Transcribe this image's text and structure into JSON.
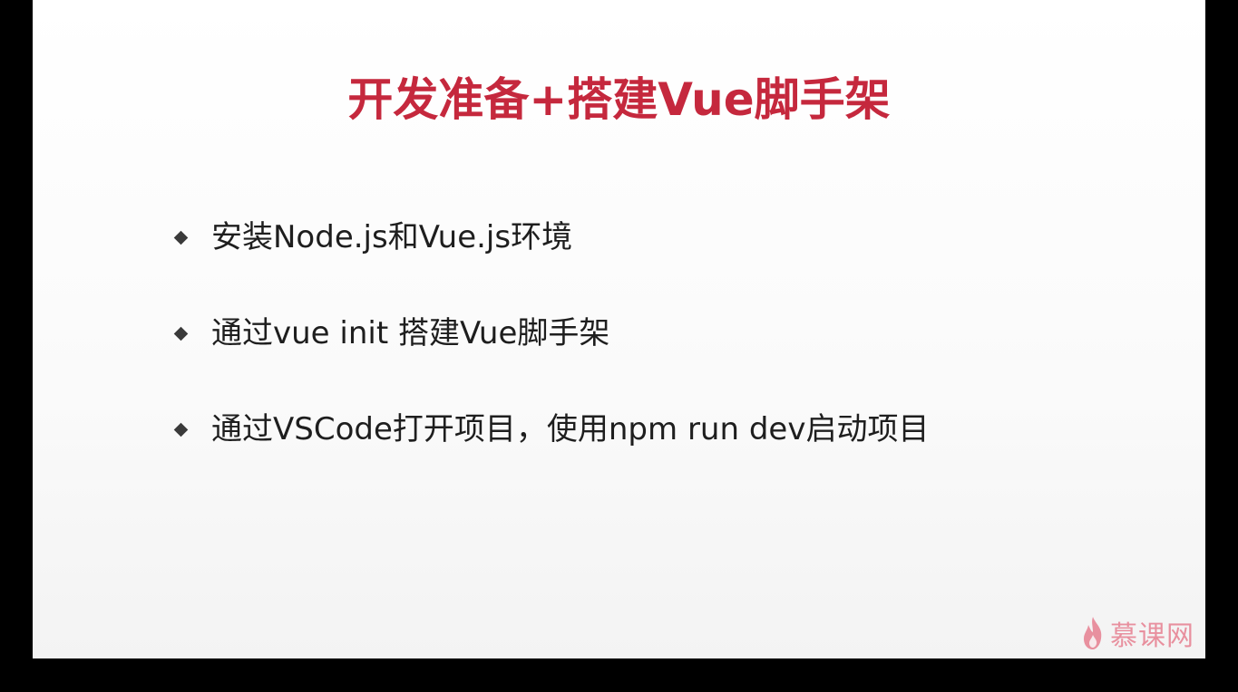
{
  "slide": {
    "title": "开发准备+搭建Vue脚手架",
    "bullets": [
      "安装Node.js和Vue.js环境",
      "通过vue init 搭建Vue脚手架",
      "通过VSCode打开项目，使用npm run dev启动项目"
    ]
  },
  "logo": {
    "icon": "flame-icon",
    "text": "慕课网"
  },
  "colors": {
    "title": "#c5283d",
    "body_text": "#1e1e1e",
    "bullet": "#3a3a3a",
    "logo": "#e0405a",
    "letterbox": "#000000"
  }
}
